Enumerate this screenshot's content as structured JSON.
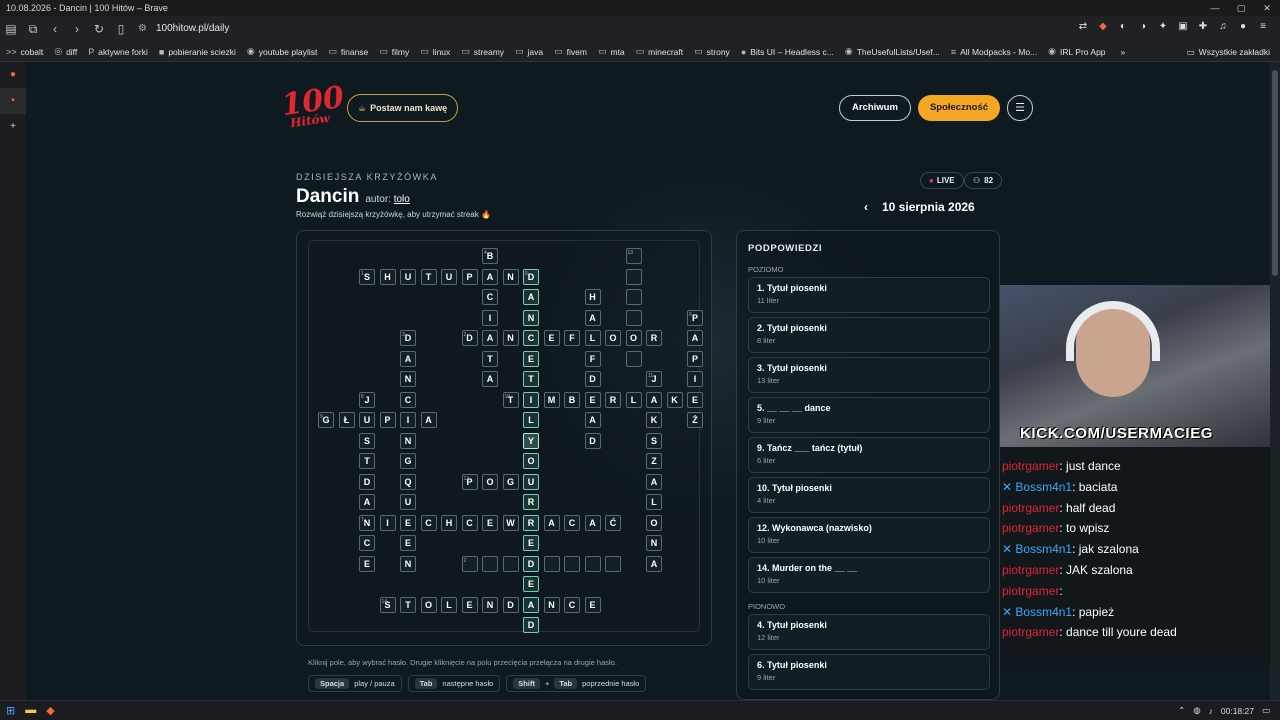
{
  "window": {
    "title": "10.08.2026 - Dancin | 100 Hitów – Brave"
  },
  "browser": {
    "url": "100hitow.pl/daily"
  },
  "bookmarks": [
    {
      "label": "cobalt",
      "icon": ">>"
    },
    {
      "label": "diff",
      "icon": "◎"
    },
    {
      "label": "aktywne forki",
      "icon": "P"
    },
    {
      "label": "pobieranie sciezki",
      "icon": "■"
    },
    {
      "label": "youtube playlist",
      "icon": "◉"
    },
    {
      "label": "finanse",
      "icon": "▭"
    },
    {
      "label": "filmy",
      "icon": "▭"
    },
    {
      "label": "linux",
      "icon": "▭"
    },
    {
      "label": "streamy",
      "icon": "▭"
    },
    {
      "label": "java",
      "icon": "▭"
    },
    {
      "label": "fivem",
      "icon": "▭"
    },
    {
      "label": "mta",
      "icon": "▭"
    },
    {
      "label": "minecraft",
      "icon": "▭"
    },
    {
      "label": "strony",
      "icon": "▭"
    },
    {
      "label": "Bits UI – Headless c...",
      "icon": "●"
    },
    {
      "label": "TheUsefulLists/Usef...",
      "icon": "◉"
    },
    {
      "label": "All Modpacks - Mo...",
      "icon": "≡"
    },
    {
      "label": "IRL Pro App",
      "icon": "◉"
    }
  ],
  "bookmarks_more": "»",
  "bookmarks_all": "Wszystkie zakładki",
  "site": {
    "logo_top": "100",
    "logo_bottom": "Hitów",
    "coffee_label": "Postaw nam kawę",
    "nav_archive": "Archiwum",
    "nav_community": "Społeczność",
    "menu_icon": "☰"
  },
  "puzzle": {
    "kicker": "DZISIEJSZA KRZYŻÓWKA",
    "title": "Dancin",
    "author_prefix": "autor:",
    "author": "tolo",
    "subtitle": "Rozwiąż dzisiejszą krzyżówkę, aby utrzymać streak 🔥",
    "live_label": "LIVE",
    "viewers": "82",
    "date": "10 sierpnia 2026",
    "help": "Kliknij pole, aby wybrać hasło. Drugie kliknięcie na polu przecięcia przełącza na drugie hasło.",
    "keys": [
      {
        "keys": [
          "Spacja"
        ],
        "action": "play / pauza"
      },
      {
        "keys": [
          "Tab"
        ],
        "action": "następne hasło"
      },
      {
        "keys": [
          "Shift",
          "Tab"
        ],
        "action": "poprzednie hasło",
        "joiner": "+"
      }
    ],
    "cells": [
      {
        "r": 0,
        "c": 8,
        "ch": "B",
        "n": "4"
      },
      {
        "r": 0,
        "c": 15,
        "ch": "",
        "n": "13"
      },
      {
        "r": 1,
        "c": 2,
        "ch": "S",
        "n": "1"
      },
      {
        "r": 1,
        "c": 3,
        "ch": "H"
      },
      {
        "r": 1,
        "c": 4,
        "ch": "U"
      },
      {
        "r": 1,
        "c": 5,
        "ch": "T"
      },
      {
        "r": 1,
        "c": 6,
        "ch": "U"
      },
      {
        "r": 1,
        "c": 7,
        "ch": "P"
      },
      {
        "r": 1,
        "c": 8,
        "ch": "A"
      },
      {
        "r": 1,
        "c": 9,
        "ch": "N"
      },
      {
        "r": 1,
        "c": 10,
        "ch": "D",
        "n": "5",
        "hl": true
      },
      {
        "r": 1,
        "c": 15,
        "ch": ""
      },
      {
        "r": 2,
        "c": 8,
        "ch": "C"
      },
      {
        "r": 2,
        "c": 10,
        "ch": "A",
        "hl": true
      },
      {
        "r": 2,
        "c": 13,
        "ch": "H"
      },
      {
        "r": 2,
        "c": 15,
        "ch": ""
      },
      {
        "r": 3,
        "c": 8,
        "ch": "I"
      },
      {
        "r": 3,
        "c": 10,
        "ch": "N",
        "hl": true
      },
      {
        "r": 3,
        "c": 13,
        "ch": "A"
      },
      {
        "r": 3,
        "c": 15,
        "ch": ""
      },
      {
        "r": 3,
        "c": 18,
        "ch": "P",
        "n": "6"
      },
      {
        "r": 4,
        "c": 4,
        "ch": "D",
        "n": "3"
      },
      {
        "r": 4,
        "c": 7,
        "ch": "D",
        "n": "2"
      },
      {
        "r": 4,
        "c": 8,
        "ch": "A"
      },
      {
        "r": 4,
        "c": 9,
        "ch": "N"
      },
      {
        "r": 4,
        "c": 10,
        "ch": "C",
        "hl": true
      },
      {
        "r": 4,
        "c": 11,
        "ch": "E"
      },
      {
        "r": 4,
        "c": 12,
        "ch": "F"
      },
      {
        "r": 4,
        "c": 13,
        "ch": "L"
      },
      {
        "r": 4,
        "c": 14,
        "ch": "O"
      },
      {
        "r": 4,
        "c": 15,
        "ch": "O"
      },
      {
        "r": 4,
        "c": 16,
        "ch": "R"
      },
      {
        "r": 4,
        "c": 18,
        "ch": "A"
      },
      {
        "r": 5,
        "c": 4,
        "ch": "A"
      },
      {
        "r": 5,
        "c": 8,
        "ch": "T"
      },
      {
        "r": 5,
        "c": 10,
        "ch": "E",
        "hl": true
      },
      {
        "r": 5,
        "c": 13,
        "ch": "F"
      },
      {
        "r": 5,
        "c": 15,
        "ch": ""
      },
      {
        "r": 5,
        "c": 18,
        "ch": "P"
      },
      {
        "r": 6,
        "c": 4,
        "ch": "N"
      },
      {
        "r": 6,
        "c": 8,
        "ch": "A"
      },
      {
        "r": 6,
        "c": 10,
        "ch": "T",
        "hl": true
      },
      {
        "r": 6,
        "c": 13,
        "ch": "D"
      },
      {
        "r": 6,
        "c": 16,
        "ch": "J",
        "n": "11"
      },
      {
        "r": 6,
        "c": 18,
        "ch": "I"
      },
      {
        "r": 7,
        "c": 2,
        "ch": "J",
        "n": "8"
      },
      {
        "r": 7,
        "c": 4,
        "ch": "C"
      },
      {
        "r": 7,
        "c": 9,
        "ch": "T",
        "n": "10"
      },
      {
        "r": 7,
        "c": 10,
        "ch": "I",
        "hl": true
      },
      {
        "r": 7,
        "c": 11,
        "ch": "M"
      },
      {
        "r": 7,
        "c": 12,
        "ch": "B"
      },
      {
        "r": 7,
        "c": 13,
        "ch": "E"
      },
      {
        "r": 7,
        "c": 14,
        "ch": "R"
      },
      {
        "r": 7,
        "c": 15,
        "ch": "L"
      },
      {
        "r": 7,
        "c": 16,
        "ch": "A"
      },
      {
        "r": 7,
        "c": 17,
        "ch": "K"
      },
      {
        "r": 7,
        "c": 18,
        "ch": "E"
      },
      {
        "r": 8,
        "c": 0,
        "ch": "G",
        "n": "9"
      },
      {
        "r": 8,
        "c": 1,
        "ch": "Ł"
      },
      {
        "r": 8,
        "c": 2,
        "ch": "U"
      },
      {
        "r": 8,
        "c": 3,
        "ch": "P"
      },
      {
        "r": 8,
        "c": 4,
        "ch": "I"
      },
      {
        "r": 8,
        "c": 5,
        "ch": "A"
      },
      {
        "r": 8,
        "c": 10,
        "ch": "L",
        "hl": true
      },
      {
        "r": 8,
        "c": 13,
        "ch": "A"
      },
      {
        "r": 8,
        "c": 16,
        "ch": "K"
      },
      {
        "r": 8,
        "c": 18,
        "ch": "Ż"
      },
      {
        "r": 9,
        "c": 2,
        "ch": "S"
      },
      {
        "r": 9,
        "c": 4,
        "ch": "N"
      },
      {
        "r": 9,
        "c": 10,
        "ch": "Y",
        "cur": true
      },
      {
        "r": 9,
        "c": 13,
        "ch": "D"
      },
      {
        "r": 9,
        "c": 16,
        "ch": "S"
      },
      {
        "r": 10,
        "c": 2,
        "ch": "T"
      },
      {
        "r": 10,
        "c": 4,
        "ch": "G"
      },
      {
        "r": 10,
        "c": 10,
        "ch": "O",
        "hl": true
      },
      {
        "r": 10,
        "c": 16,
        "ch": "Z"
      },
      {
        "r": 11,
        "c": 2,
        "ch": "D"
      },
      {
        "r": 11,
        "c": 4,
        "ch": "Q"
      },
      {
        "r": 11,
        "c": 7,
        "ch": "P",
        "n": "12"
      },
      {
        "r": 11,
        "c": 8,
        "ch": "O"
      },
      {
        "r": 11,
        "c": 9,
        "ch": "G"
      },
      {
        "r": 11,
        "c": 10,
        "ch": "U",
        "hl": true
      },
      {
        "r": 11,
        "c": 16,
        "ch": "A"
      },
      {
        "r": 12,
        "c": 2,
        "ch": "A"
      },
      {
        "r": 12,
        "c": 4,
        "ch": "U"
      },
      {
        "r": 12,
        "c": 10,
        "ch": "R",
        "hl": true
      },
      {
        "r": 12,
        "c": 16,
        "ch": "L"
      },
      {
        "r": 13,
        "c": 2,
        "ch": "N",
        "n": "7"
      },
      {
        "r": 13,
        "c": 3,
        "ch": "I"
      },
      {
        "r": 13,
        "c": 4,
        "ch": "E"
      },
      {
        "r": 13,
        "c": 5,
        "ch": "C"
      },
      {
        "r": 13,
        "c": 6,
        "ch": "H"
      },
      {
        "r": 13,
        "c": 7,
        "ch": "C"
      },
      {
        "r": 13,
        "c": 8,
        "ch": "E"
      },
      {
        "r": 13,
        "c": 9,
        "ch": "W"
      },
      {
        "r": 13,
        "c": 10,
        "ch": "R",
        "hl": true
      },
      {
        "r": 13,
        "c": 11,
        "ch": "A"
      },
      {
        "r": 13,
        "c": 12,
        "ch": "C"
      },
      {
        "r": 13,
        "c": 13,
        "ch": "A"
      },
      {
        "r": 13,
        "c": 14,
        "ch": "Ć"
      },
      {
        "r": 13,
        "c": 16,
        "ch": "O"
      },
      {
        "r": 14,
        "c": 2,
        "ch": "C"
      },
      {
        "r": 14,
        "c": 4,
        "ch": "E"
      },
      {
        "r": 14,
        "c": 10,
        "ch": "E",
        "hl": true
      },
      {
        "r": 14,
        "c": 16,
        "ch": "N"
      },
      {
        "r": 15,
        "c": 2,
        "ch": "E"
      },
      {
        "r": 15,
        "c": 4,
        "ch": "N"
      },
      {
        "r": 15,
        "c": 7,
        "ch": "",
        "n": "2"
      },
      {
        "r": 15,
        "c": 8,
        "ch": ""
      },
      {
        "r": 15,
        "c": 9,
        "ch": ""
      },
      {
        "r": 15,
        "c": 10,
        "ch": "D",
        "hl": true
      },
      {
        "r": 15,
        "c": 11,
        "ch": ""
      },
      {
        "r": 15,
        "c": 12,
        "ch": ""
      },
      {
        "r": 15,
        "c": 13,
        "ch": ""
      },
      {
        "r": 15,
        "c": 14,
        "ch": ""
      },
      {
        "r": 15,
        "c": 16,
        "ch": "A"
      },
      {
        "r": 16,
        "c": 10,
        "ch": "E",
        "hl": true
      },
      {
        "r": 17,
        "c": 3,
        "ch": "S",
        "n": "14"
      },
      {
        "r": 17,
        "c": 4,
        "ch": "T"
      },
      {
        "r": 17,
        "c": 5,
        "ch": "O"
      },
      {
        "r": 17,
        "c": 6,
        "ch": "L"
      },
      {
        "r": 17,
        "c": 7,
        "ch": "E"
      },
      {
        "r": 17,
        "c": 8,
        "ch": "N"
      },
      {
        "r": 17,
        "c": 9,
        "ch": "D"
      },
      {
        "r": 17,
        "c": 10,
        "ch": "A",
        "hl": true
      },
      {
        "r": 17,
        "c": 11,
        "ch": "N"
      },
      {
        "r": 17,
        "c": 12,
        "ch": "C"
      },
      {
        "r": 17,
        "c": 13,
        "ch": "E"
      },
      {
        "r": 18,
        "c": 10,
        "ch": "D",
        "hl": true
      }
    ]
  },
  "hints": {
    "title": "PODPOWIEDZI",
    "across_label": "POZIOMO",
    "down_label": "PIONOWO",
    "across": [
      {
        "label": "1. Tytuł piosenki",
        "len": "11 liter"
      },
      {
        "label": "2. Tytuł piosenki",
        "len": "8 liter"
      },
      {
        "label": "3. Tytuł piosenki",
        "len": "13 liter"
      },
      {
        "label": "5. __ __ __ dance",
        "len": "9 liter"
      },
      {
        "label": "9. Tańcz ___ tańcz (tytuł)",
        "len": "6 liter"
      },
      {
        "label": "10. Tytuł piosenki",
        "len": "4 liter"
      },
      {
        "label": "12. Wykonawca (nazwisko)",
        "len": "10 liter"
      },
      {
        "label": "14. Murder on the __ __",
        "len": "10 liter"
      }
    ],
    "down": [
      {
        "label": "4. Tytuł piosenki",
        "len": "12 liter"
      },
      {
        "label": "6. Tytuł piosenki",
        "len": "9 liter"
      }
    ]
  },
  "stream": {
    "overlay": "KICK.COM/USERMACIEG"
  },
  "chat": [
    {
      "user": "piotrgamer",
      "text": ": just dance",
      "type": "u1"
    },
    {
      "user": "Bossm4n1",
      "text": ": baciata",
      "type": "u2"
    },
    {
      "user": "piotrgamer",
      "text": ": half dead",
      "type": "u1"
    },
    {
      "user": "piotrgamer",
      "text": ": to wpisz",
      "type": "u1"
    },
    {
      "user": "Bossm4n1",
      "text": ": jak szalona",
      "type": "u2"
    },
    {
      "user": "piotrgamer",
      "text": ": JAK szalona",
      "type": "u1"
    },
    {
      "user": "piotrgamer",
      "text": ":",
      "type": "u1"
    },
    {
      "user": "Bossm4n1",
      "text": ": papież",
      "type": "u2"
    },
    {
      "user": "piotrgamer",
      "text": ": dance till youre dead",
      "type": "u1"
    }
  ],
  "taskbar": {
    "time": "00:18:27"
  }
}
